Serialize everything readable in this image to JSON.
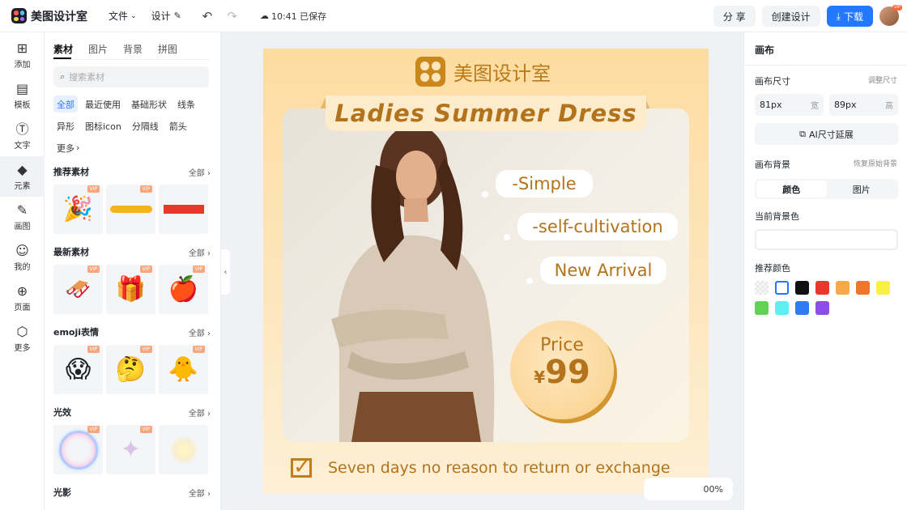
{
  "app": {
    "name": "美图设计室"
  },
  "topbar": {
    "file_menu": "文件",
    "design_menu": "设计",
    "save_status": "10:41 已保存",
    "share": "分 享",
    "create_design": "创建设计",
    "download": "下载"
  },
  "rail": {
    "items": [
      {
        "label": "添加",
        "icon": "plus-square-icon"
      },
      {
        "label": "模板",
        "icon": "layout-icon"
      },
      {
        "label": "文字",
        "icon": "text-icon"
      },
      {
        "label": "元素",
        "icon": "shapes-icon",
        "active": true
      },
      {
        "label": "画图",
        "icon": "pencil-icon"
      },
      {
        "label": "我的",
        "icon": "user-icon"
      },
      {
        "label": "页面",
        "icon": "page-add-icon"
      },
      {
        "label": "更多",
        "icon": "cube-icon"
      }
    ]
  },
  "panel": {
    "tabs": [
      "素材",
      "图片",
      "背景",
      "拼图"
    ],
    "search_placeholder": "搜索素材",
    "chips": [
      "全部",
      "最近使用",
      "基础形状",
      "线条",
      "异形",
      "图标icon",
      "分隔线",
      "箭头",
      "更多"
    ],
    "vip": "VIP",
    "sections": [
      {
        "title": "推荐素材",
        "all": "全部"
      },
      {
        "title": "最新素材",
        "all": "全部"
      },
      {
        "title": "emoji表情",
        "all": "全部"
      },
      {
        "title": "光效",
        "all": "全部"
      },
      {
        "title": "光影",
        "all": "全部"
      }
    ]
  },
  "poster": {
    "brand": "美图设计室",
    "headline": "Ladies Summer Dress",
    "bubbles": [
      "-Simple",
      "-self-cultivation",
      "New Arrival"
    ],
    "price_label": "Price",
    "price_currency": "¥",
    "price_value": "99",
    "footer": "Seven days no reason to return or exchange"
  },
  "zoom": {
    "value": "00%"
  },
  "right_panel": {
    "title": "画布",
    "size_label": "画布尺寸",
    "size_adjust": "调整尺寸",
    "width_value": "81px",
    "width_unit": "宽",
    "height_value": "89px",
    "height_unit": "高",
    "ai_extend": "AI尺寸延展",
    "bg_label": "画布背景",
    "bg_restore": "恢复原始背景",
    "seg_color": "颜色",
    "seg_image": "图片",
    "current_bg": "当前背景色",
    "recommended": "推荐颜色",
    "swatches": [
      "#f3f3f3",
      "#ffffff",
      "#111111",
      "#e8382c",
      "#f5a94a",
      "#f0762b",
      "#f8f042",
      "#63d153",
      "#5ef0f0",
      "#2f7bf2",
      "#8c4ee8"
    ]
  },
  "colors": {
    "accent": "#2478ff",
    "poster_gold": "#b3731c"
  }
}
